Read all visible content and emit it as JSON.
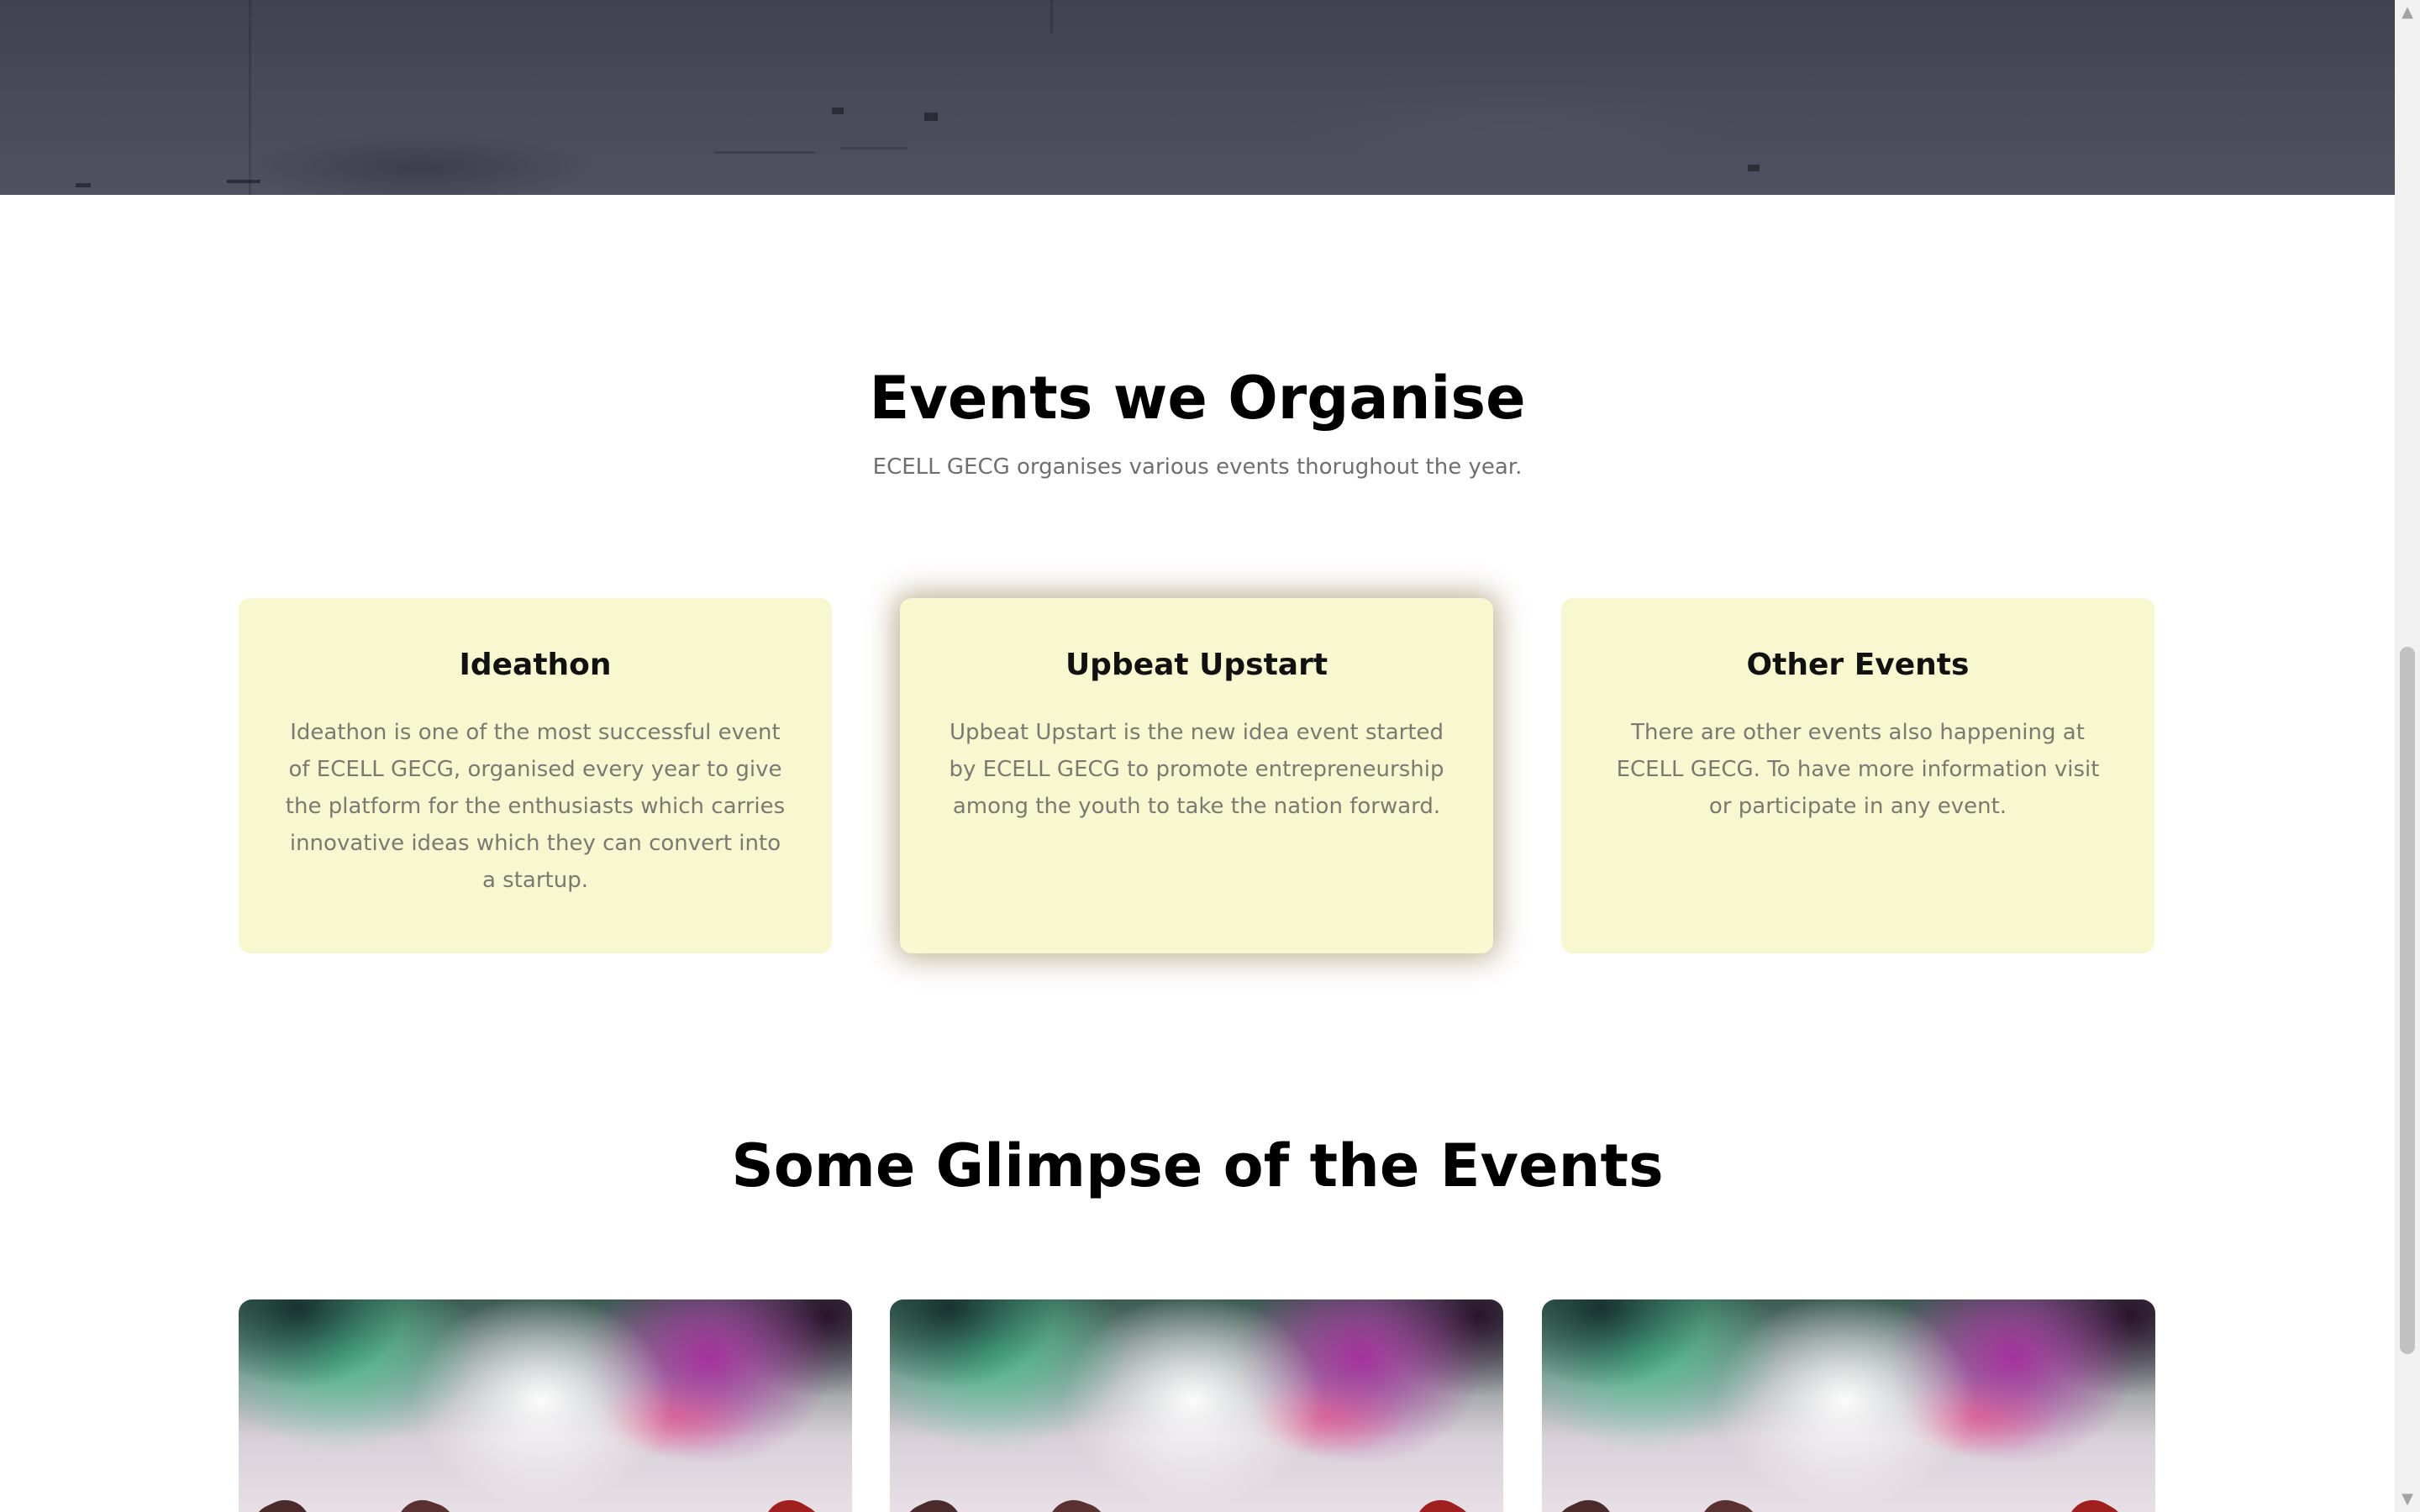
{
  "events_section": {
    "title": "Events we Organise",
    "subtitle": "ECELL GECG organises various events thorughout the year.",
    "cards": [
      {
        "title": "Ideathon",
        "text": "Ideathon is one of the most successful event of ECELL GECG, organised every year to give the platform for the enthusiasts which carries innovative ideas which they can convert into a startup."
      },
      {
        "title": "Upbeat Upstart",
        "text": "Upbeat Upstart is the new idea event started by ECELL GECG to promote entrepreneurship among the youth to take the nation forward."
      },
      {
        "title": "Other Events",
        "text": "There are other events also happening at ECELL GECG. To have more information visit or participate in any event."
      }
    ]
  },
  "glimpse_section": {
    "title": "Some Glimpse of the Events"
  },
  "scrollbar": {
    "up_arrow_icon": "▲",
    "down_arrow_icon": "▼"
  },
  "colors": {
    "card_background": "#f7f8cf",
    "hero_overlay": "#4a4a58",
    "highlight_shadow": "#6e5014"
  }
}
